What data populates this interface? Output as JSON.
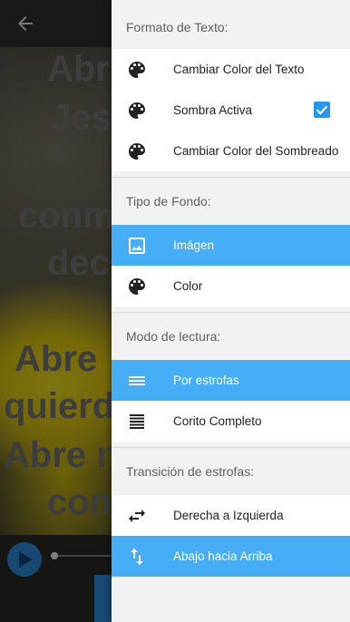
{
  "background_app": {
    "lyrics_lines": [
      "Abr",
      "Jes",
      "conm",
      "dec",
      "Abre",
      "quierd",
      "Abre n",
      "con"
    ]
  },
  "drawer": {
    "sections": [
      {
        "header": "Formato de Texto:",
        "items": [
          {
            "label": "Cambiar Color del Texto",
            "icon": "palette-icon",
            "active": false
          },
          {
            "label": "Sombra Activa",
            "icon": "palette-icon",
            "active": false,
            "checked": true
          },
          {
            "label": "Cambiar Color del Sombreado",
            "icon": "palette-icon",
            "active": false
          }
        ]
      },
      {
        "header": "Tipo de Fondo:",
        "items": [
          {
            "label": "Imágen",
            "icon": "image-icon",
            "active": true
          },
          {
            "label": "Color",
            "icon": "palette-icon",
            "active": false
          }
        ]
      },
      {
        "header": "Modo de lectura:",
        "items": [
          {
            "label": "Por estrofas",
            "icon": "short-lines-icon",
            "active": true
          },
          {
            "label": "Corito Completo",
            "icon": "full-lines-icon",
            "active": false
          }
        ]
      },
      {
        "header": "Transición de estrofas:",
        "items": [
          {
            "label": "Derecha a Izquierda",
            "icon": "swap-horizontal-icon",
            "active": false
          },
          {
            "label": "Abajo hacia Arriba",
            "icon": "swap-vertical-icon",
            "active": true
          }
        ]
      }
    ]
  },
  "colors": {
    "accent": "#45aef6",
    "checkbox": "#2196f3"
  }
}
